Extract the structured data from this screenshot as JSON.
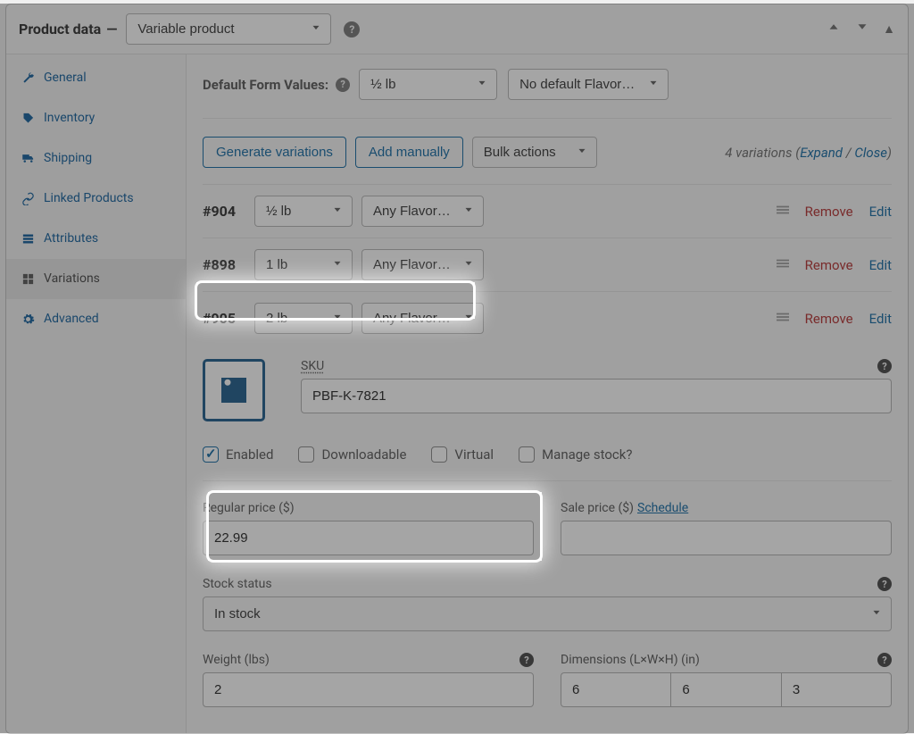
{
  "header": {
    "title": "Product data",
    "dash": "—",
    "product_type": "Variable product"
  },
  "sidebar": {
    "items": [
      {
        "label": "General"
      },
      {
        "label": "Inventory"
      },
      {
        "label": "Shipping"
      },
      {
        "label": "Linked Products"
      },
      {
        "label": "Attributes"
      },
      {
        "label": "Variations"
      },
      {
        "label": "Advanced"
      }
    ]
  },
  "defaults": {
    "label": "Default Form Values:",
    "weight": "½ lb",
    "flavor": "No default Flavor…"
  },
  "actions": {
    "generate": "Generate variations",
    "add_manually": "Add manually",
    "bulk": "Bulk actions",
    "count_text_prefix": "4 variations",
    "expand": "Expand",
    "close": "Close"
  },
  "variations": [
    {
      "id": "#904",
      "weight": "½ lb",
      "flavor": "Any Flavor…",
      "remove": "Remove",
      "edit": "Edit"
    },
    {
      "id": "#898",
      "weight": "1 lb",
      "flavor": "Any Flavor…",
      "remove": "Remove",
      "edit": "Edit"
    },
    {
      "id": "#905",
      "weight": "2 lb",
      "flavor": "Any Flavor…",
      "remove": "Remove",
      "edit": "Edit"
    }
  ],
  "expanded": {
    "sku_label": "SKU",
    "sku_value": "PBF-K-7821",
    "enabled": "Enabled",
    "downloadable": "Downloadable",
    "virtual": "Virtual",
    "manage_stock": "Manage stock?",
    "regular_price_label": "Regular price ($)",
    "regular_price_value": "22.99",
    "sale_price_label": "Sale price ($)",
    "sale_price_value": "",
    "schedule": "Schedule",
    "stock_status_label": "Stock status",
    "stock_status_value": "In stock",
    "weight_label": "Weight (lbs)",
    "weight_value": "2",
    "dimensions_label": "Dimensions (L×W×H) (in)",
    "dim_l": "6",
    "dim_w": "6",
    "dim_h": "3"
  }
}
